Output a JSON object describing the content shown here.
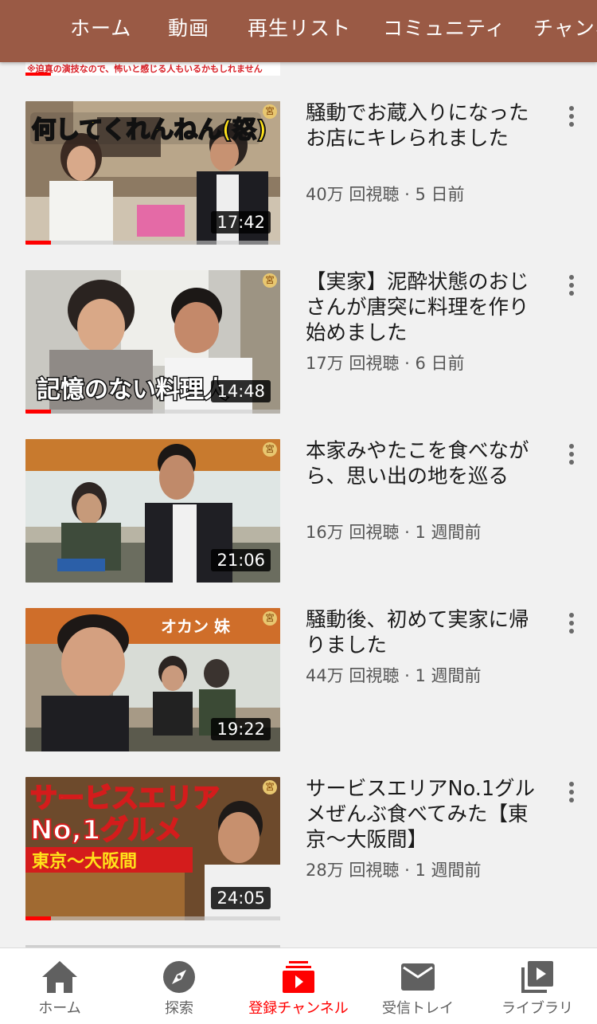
{
  "header": {
    "tabs": [
      "ホーム",
      "動画",
      "再生リスト",
      "コミュニティ",
      "チャンネル"
    ]
  },
  "partial_thumb_caption": "※迫真の演技なので、怖いと感じる人もいるかもしれません",
  "videos": [
    {
      "title": "騒動でお蔵入りになったお店にキレられました",
      "views": "40万 回視聴",
      "age": "5 日前",
      "duration": "17:42",
      "thumb_text": "何してくれんねん(怒)",
      "badge": "宮",
      "progress": 0.1
    },
    {
      "title": "【実家】泥酔状態のおじさんが唐突に料理を作り始めました",
      "views": "17万 回視聴",
      "age": "6 日前",
      "duration": "14:48",
      "thumb_text": "記憶のない料理人",
      "badge": "宮",
      "progress": 0.1
    },
    {
      "title": "本家みやたこを食べながら、思い出の地を巡る",
      "views": "16万 回視聴",
      "age": "1 週間前",
      "duration": "21:06",
      "thumb_text": "",
      "badge": "宮",
      "progress": 0
    },
    {
      "title": "騒動後、初めて実家に帰りました",
      "views": "44万 回視聴",
      "age": "1 週間前",
      "duration": "19:22",
      "thumb_text": "オカン 妹",
      "badge": "宮",
      "progress": 0
    },
    {
      "title": "サービスエリアNo.1グルメぜんぶ食べてみた【東京〜大阪間】",
      "views": "28万 回視聴",
      "age": "1 週間前",
      "duration": "24:05",
      "thumb_text": "サービスエリア No,1グルメ 東京〜大阪間",
      "badge": "宮",
      "progress": 0.1
    }
  ],
  "meta_separator": " · ",
  "bottom_nav": [
    {
      "label": "ホーム",
      "icon": "home-icon",
      "active": false
    },
    {
      "label": "探索",
      "icon": "explore-icon",
      "active": false
    },
    {
      "label": "登録チャンネル",
      "icon": "subscriptions-icon",
      "active": true
    },
    {
      "label": "受信トレイ",
      "icon": "inbox-icon",
      "active": false
    },
    {
      "label": "ライブラリ",
      "icon": "library-icon",
      "active": false
    }
  ],
  "colors": {
    "header_bg": "#9a5a45",
    "accent": "#ff0000",
    "page_bg": "#f1f1f1"
  }
}
